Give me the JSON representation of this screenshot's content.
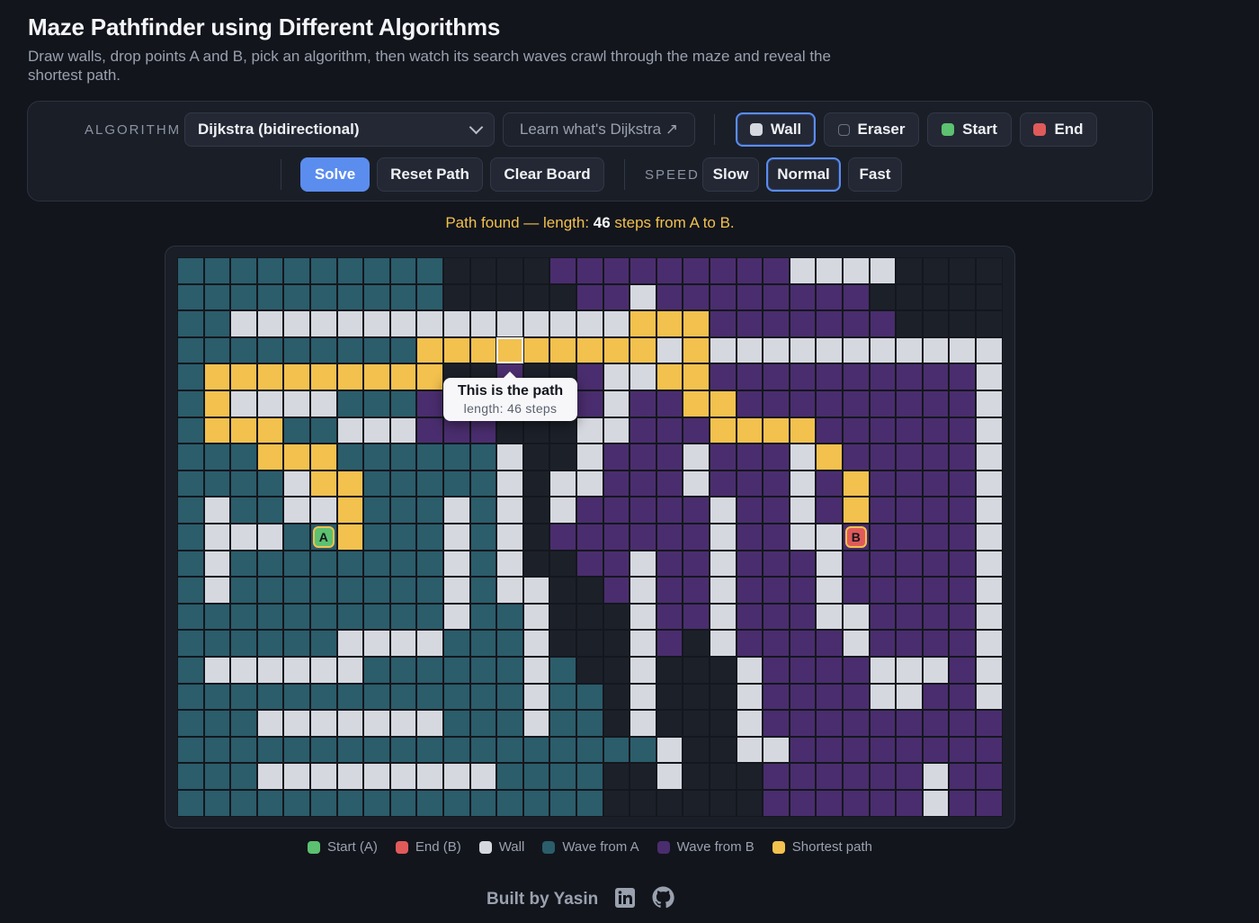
{
  "header": {
    "title": "Maze Pathfinder using Different Algorithms",
    "subtitle": "Draw walls, drop points A and B, pick an algorithm, then watch its search waves crawl through the maze and reveal the shortest path."
  },
  "toolbar": {
    "algorithm_label": "ALGORITHM",
    "algorithm_value": "Dijkstra (bidirectional)",
    "learn_link": "Learn what's Dijkstra ↗",
    "tools": [
      {
        "label": "Wall",
        "active": true
      },
      {
        "label": "Eraser",
        "active": false
      },
      {
        "label": "Start",
        "active": false
      },
      {
        "label": "End",
        "active": false
      }
    ],
    "solve_label": "Solve",
    "reset_label": "Reset Path",
    "clear_label": "Clear Board",
    "speed_label": "SPEED",
    "speeds": [
      {
        "label": "Slow",
        "active": false
      },
      {
        "label": "Normal",
        "active": true
      },
      {
        "label": "Fast",
        "active": false
      }
    ]
  },
  "status": {
    "prefix": "Path found — length: ",
    "length": "46",
    "suffix": " steps from A to B."
  },
  "tooltip": {
    "title": "This is the path",
    "subtitle": "length: 46 steps"
  },
  "board": {
    "rows": 21,
    "cols": 31,
    "start": {
      "label": "A",
      "row": 10,
      "col": 5
    },
    "end": {
      "label": "B",
      "row": 10,
      "col": 25
    },
    "cells": [
      "AAAAAAAAAA....BBBBBBBBBWWWW....",
      "AAAAAAAAAA.....BBWBBBBBBBB.....",
      "AAWWWWWWWWWWWWWWWPPPBBBBBBB....",
      "AAAAAAAAAPPPPPPPPPWPWWWWWWWWWWW",
      "APPPPPPPPP..B..BWWPPBBBBBBBBBBW",
      "APWWWWAAABBB...BWBBPPBBBBBBBBBW",
      "APPPAAWWWBBB...WWBBBPPPPBBBBBBW",
      "AAAPPPAAAAAAW..WBBBWBBBWPBBBBBW",
      "AAAAWPPAAAAAW.WWBBBWBBBWBPBBBBW",
      "AWAAWWPAAAWAW.WBBBBBWBBWBPBBBBW",
      "AWWWAAPAAAWAW.BBBBBBWBBWWBBBBBW",
      "AWAAAAAAAAWAW..BBWBBWBBBWBBBBBW",
      "AWAAAAAAAAWAWW..BWBBWBBBWBBBBBW",
      "AAAAAAAAAAWAAW...WBBWBBBWWBBBBW",
      "AAAAAAWWWWAAAW...WB.WBBBBWBBBBW",
      "AWWWWWWAAAAAAWA..W...WBBBBWWWBW",
      "AAAAAAAAAAAAAWAA.W...WBBBBWWBBW",
      "AAAWWWWWWWAAAWAA.W...WBBBBBBBBB",
      "AAAAAAAAAAAAAAAAAAW..WWBBBBBBBB",
      "AAAWWWWWWWWWAAAA..W...BBBBBBWBB",
      "AAAAAAAAAAAAAAAA......BBBBBBWBB"
    ]
  },
  "colors": {
    "empty": "#1c2029",
    "wall": "#d6d8e0",
    "wave_a": "#2b5d6b",
    "wave_b": "#4a2d6e",
    "path": "#f2c14e",
    "start": "#5cc170",
    "end": "#e05a5a",
    "accent": "#5b8def"
  },
  "legend": [
    {
      "label": "Start (A)",
      "color": "#5cc170"
    },
    {
      "label": "End (B)",
      "color": "#e05a5a"
    },
    {
      "label": "Wall",
      "color": "#d6d8e0"
    },
    {
      "label": "Wave from A",
      "color": "#2b5d6b"
    },
    {
      "label": "Wave from B",
      "color": "#4a2d6e"
    },
    {
      "label": "Shortest path",
      "color": "#f2c14e"
    }
  ],
  "footer": {
    "text": "Built by Yasin",
    "icons": [
      "linkedin-icon",
      "github-icon"
    ]
  }
}
